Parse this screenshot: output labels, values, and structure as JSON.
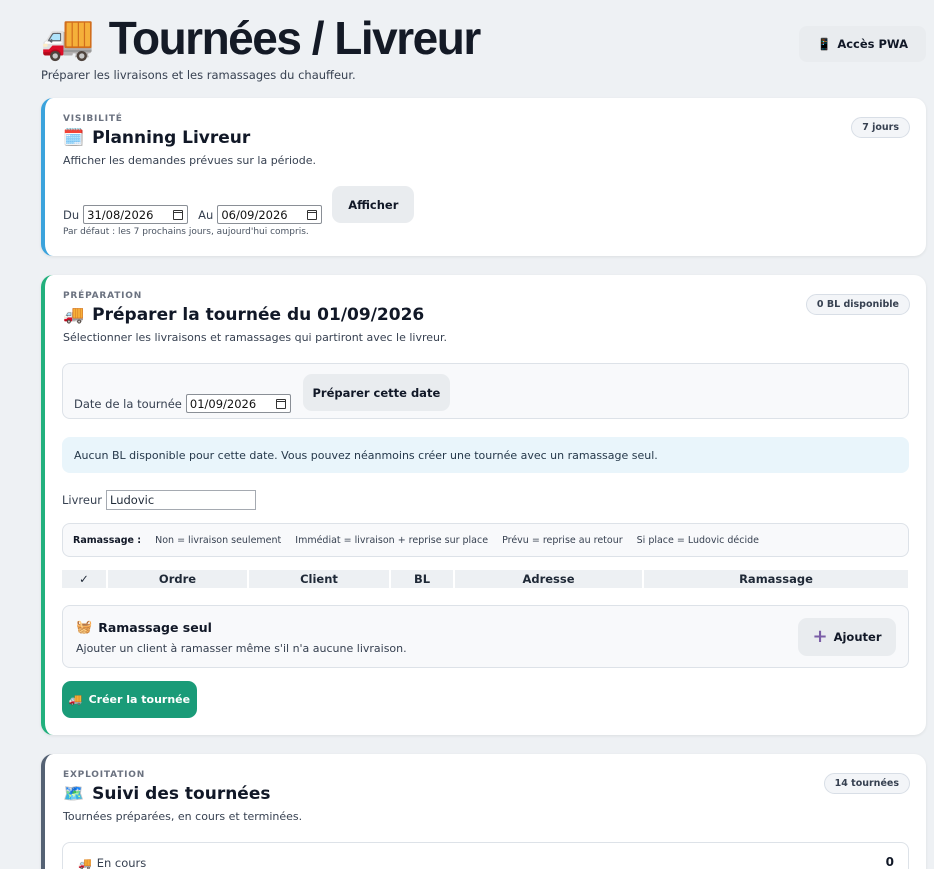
{
  "header": {
    "emoji": "🚚",
    "title": "Tournées / Livreur",
    "subtitle": "Préparer les livraisons et les ramassages du chauffeur.",
    "pwa_button": {
      "icon": "📱",
      "label": "Accès PWA"
    }
  },
  "planning": {
    "kicker": "VISIBILITÉ",
    "emoji": "🗓️",
    "title": "Planning Livreur",
    "badge": "7 jours",
    "description": "Afficher les demandes prévues sur la période.",
    "from_label": "Du",
    "from_value": "31/08/2026",
    "to_label": "Au",
    "to_value": "06/09/2026",
    "show_button": "Afficher",
    "note": "Par défaut : les 7 prochains jours, aujourd'hui compris."
  },
  "preparation": {
    "kicker": "PRÉPARATION",
    "emoji": "🚚",
    "title": "Préparer la tournée du 01/09/2026",
    "badge": "0 BL disponible",
    "description": "Sélectionner les livraisons et ramassages qui partiront avec le livreur.",
    "date_label": "Date de la tournée",
    "date_value": "01/09/2026",
    "prepare_button": "Préparer cette date",
    "info": "Aucun BL disponible pour cette date. Vous pouvez néanmoins créer une tournée avec un ramassage seul.",
    "driver_label": "Livreur",
    "driver_value": "Ludovic",
    "legend": {
      "title": "Ramassage :",
      "items": [
        "Non = livraison seulement",
        "Immédiat = livraison + reprise sur place",
        "Prévu = reprise au retour",
        "Si place = Ludovic décide"
      ]
    },
    "table_headers": [
      "✓",
      "Ordre",
      "Client",
      "BL",
      "Adresse",
      "Ramassage"
    ],
    "pickup_only": {
      "emoji": "🧺",
      "title": "Ramassage seul",
      "description": "Ajouter un client à ramasser même s'il n'a aucune livraison.",
      "add_button_icon": "+",
      "add_button": "Ajouter"
    },
    "create_button": {
      "emoji": "🚚",
      "label": "Créer la tournée"
    }
  },
  "tracking": {
    "kicker": "EXPLOITATION",
    "emoji": "🗺️",
    "title": "Suivi des tournées",
    "badge": "14 tournées",
    "description": "Tournées préparées, en cours et terminées.",
    "in_progress": {
      "emoji": "🚚",
      "label": "En cours",
      "count": "0"
    }
  },
  "colors": {
    "planning_accent": "#3ba3dc",
    "preparation_accent": "#22b07d",
    "tracking_accent": "#556274",
    "create_button": "#1a9b78",
    "add_icon": "#7b5ea7"
  }
}
